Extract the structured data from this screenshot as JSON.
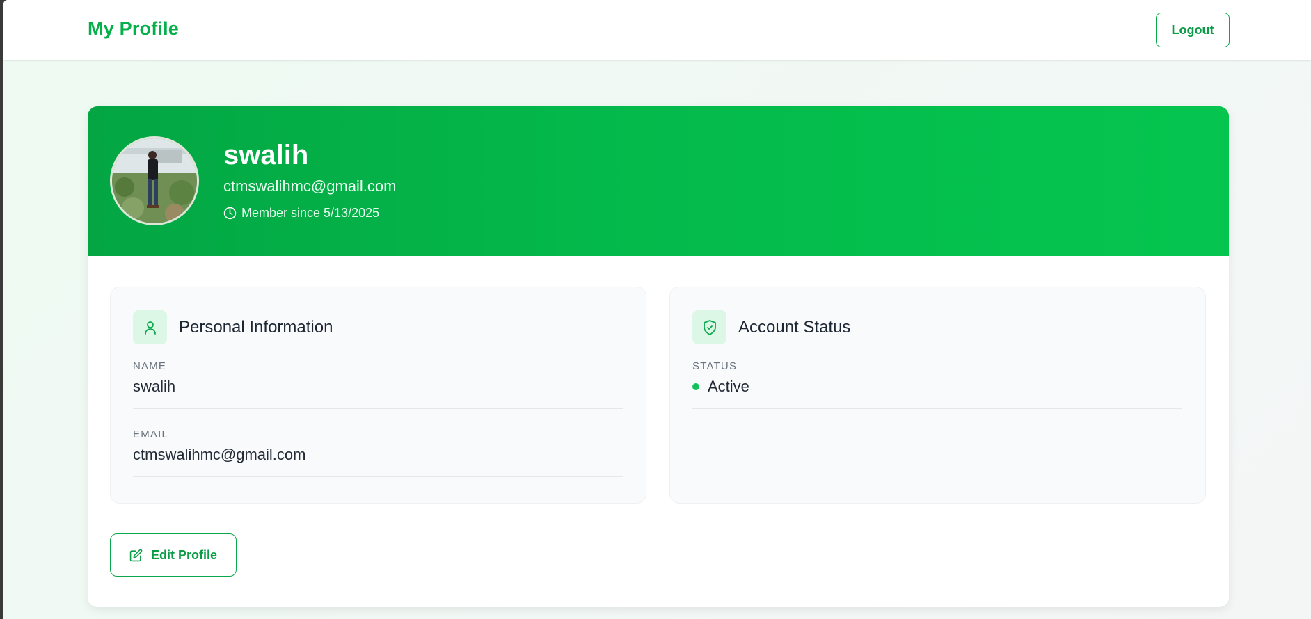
{
  "header": {
    "title": "My Profile",
    "logout_label": "Logout"
  },
  "profile": {
    "name": "swalih",
    "email": "ctmswalihmc@gmail.com",
    "member_since": "Member since 5/13/2025"
  },
  "personal_info": {
    "title": "Personal Information",
    "icon": "user-icon",
    "fields": [
      {
        "label": "NAME",
        "value": "swalih"
      },
      {
        "label": "EMAIL",
        "value": "ctmswalihmc@gmail.com"
      }
    ]
  },
  "account_status": {
    "title": "Account Status",
    "icon": "shield-check-icon",
    "status_label": "STATUS",
    "status_value": "Active"
  },
  "actions": {
    "edit_label": "Edit Profile"
  },
  "colors": {
    "brand": "#05b04b",
    "hero_start": "#03a643",
    "hero_end": "#05c54f",
    "status_active": "#12c15a",
    "icon_bg": "#dcf7e6"
  }
}
